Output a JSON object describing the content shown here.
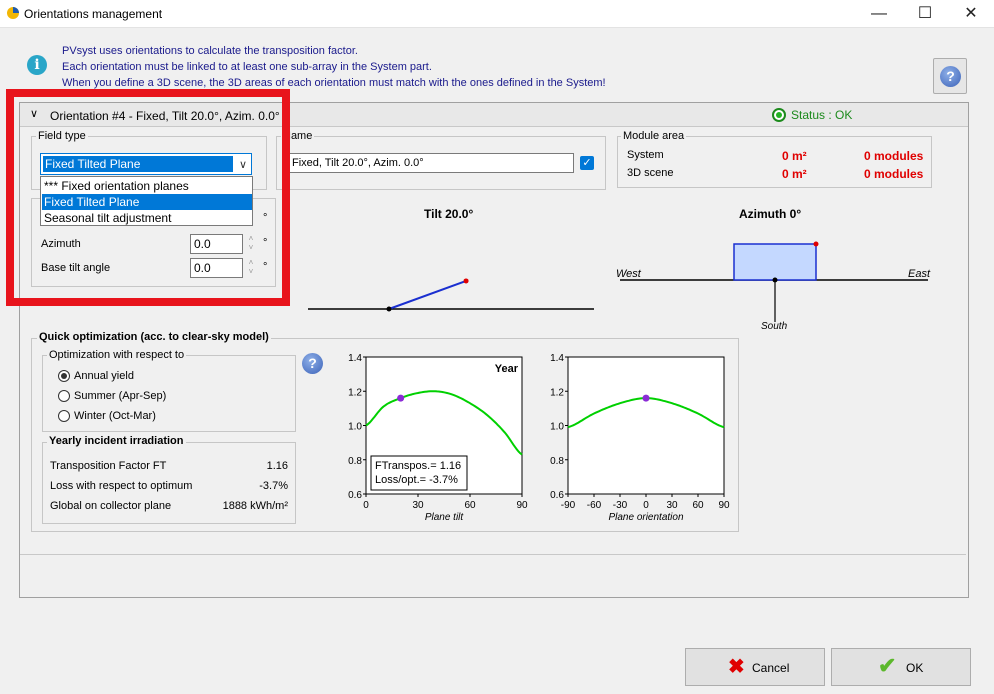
{
  "window": {
    "title": "Orientations management",
    "minimize": "—",
    "maximize": "☐",
    "close": "✕"
  },
  "info": {
    "line1": "PVsyst uses orientations to calculate the transposition factor.",
    "line2": "Each orientation must be linked to at least one sub-array in the System part.",
    "line3": "When you define a 3D scene, the 3D areas of each orientation must match with the ones defined in the System!"
  },
  "orientation": {
    "header": "Orientation #4 - Fixed, Tilt 20.0°, Azim. 0.0°",
    "status": "Status : OK",
    "field_type": {
      "legend": "Field type",
      "selected": "Fixed Tilted Plane",
      "options": [
        "*** Fixed orientation planes",
        "Fixed Tilted Plane",
        "Seasonal tilt adjustment"
      ]
    },
    "name": {
      "legend": "Name",
      "value": "Fixed, Tilt 20.0°, Azim. 0.0°"
    },
    "module_area": {
      "legend": "Module area",
      "rows": [
        {
          "label": "System",
          "area": "0 m²",
          "modules": "0 modules"
        },
        {
          "label": "3D scene",
          "area": "0 m²",
          "modules": "0 modules"
        }
      ]
    },
    "params": {
      "azimuth_label": "Azimuth",
      "azimuth_value": "0.0",
      "base_tilt_label": "Base tilt angle",
      "base_tilt_value": "0.0",
      "degree": "°"
    },
    "tilt_diagram": {
      "title": "Tilt 20.0°",
      "tilt_deg": 20
    },
    "azimuth_diagram": {
      "title": "Azimuth 0°",
      "west": "West",
      "east": "East",
      "south": "South",
      "azimuth_deg": 0
    }
  },
  "quick_opt": {
    "legend": "Quick optimization (acc. to clear-sky model)",
    "opt_legend": "Optimization with respect to",
    "options": [
      {
        "label": "Annual yield",
        "checked": true
      },
      {
        "label": "Summer (Apr-Sep)",
        "checked": false
      },
      {
        "label": "Winter (Oct-Mar)",
        "checked": false
      }
    ],
    "yearly": {
      "legend": "Yearly incident irradiation",
      "rows": [
        {
          "label": "Transposition Factor FT",
          "value": "1.16"
        },
        {
          "label": "Loss with respect to optimum",
          "value": "-3.7%"
        },
        {
          "label": "Global on collector plane",
          "value": "1888 kWh/m²"
        }
      ]
    }
  },
  "chart_data": [
    {
      "type": "line",
      "xlabel": "Plane tilt",
      "ylabel": "",
      "corner_label": "Year",
      "xlim": [
        0,
        90
      ],
      "ylim": [
        0.6,
        1.4
      ],
      "xticks": [
        "0",
        "30",
        "60",
        "90"
      ],
      "yticks": [
        "0.6",
        "0.8",
        "1.0",
        "1.2",
        "1.4"
      ],
      "x": [
        0,
        10,
        20,
        30,
        40,
        50,
        60,
        70,
        80,
        90
      ],
      "y": [
        1.0,
        1.11,
        1.16,
        1.19,
        1.2,
        1.18,
        1.13,
        1.06,
        0.96,
        0.83
      ],
      "marker": {
        "x": 20,
        "y": 1.16
      },
      "annotation": [
        "FTranspos.= 1.16",
        "Loss/opt.= -3.7%"
      ],
      "line_color": "#00d000",
      "marker_color": "#8b2bd6"
    },
    {
      "type": "line",
      "xlabel": "Plane orientation",
      "ylabel": "",
      "xlim": [
        -90,
        90
      ],
      "ylim": [
        0.6,
        1.4
      ],
      "xticks": [
        "-90",
        "-60",
        "-30",
        "0",
        "30",
        "60",
        "90"
      ],
      "yticks": [
        "0.6",
        "0.8",
        "1.0",
        "1.2",
        "1.4"
      ],
      "x": [
        -90,
        -60,
        -30,
        0,
        30,
        60,
        90
      ],
      "y": [
        0.99,
        1.07,
        1.13,
        1.16,
        1.13,
        1.07,
        0.99
      ],
      "marker": {
        "x": 0,
        "y": 1.16
      },
      "line_color": "#00d000",
      "marker_color": "#8b2bd6"
    }
  ],
  "buttons": {
    "cancel": "Cancel",
    "ok": "OK"
  },
  "colors": {
    "highlight": "#e8141c",
    "status": "#1c8a1c",
    "accent": "#0078d7",
    "red_text": "#e00000"
  }
}
